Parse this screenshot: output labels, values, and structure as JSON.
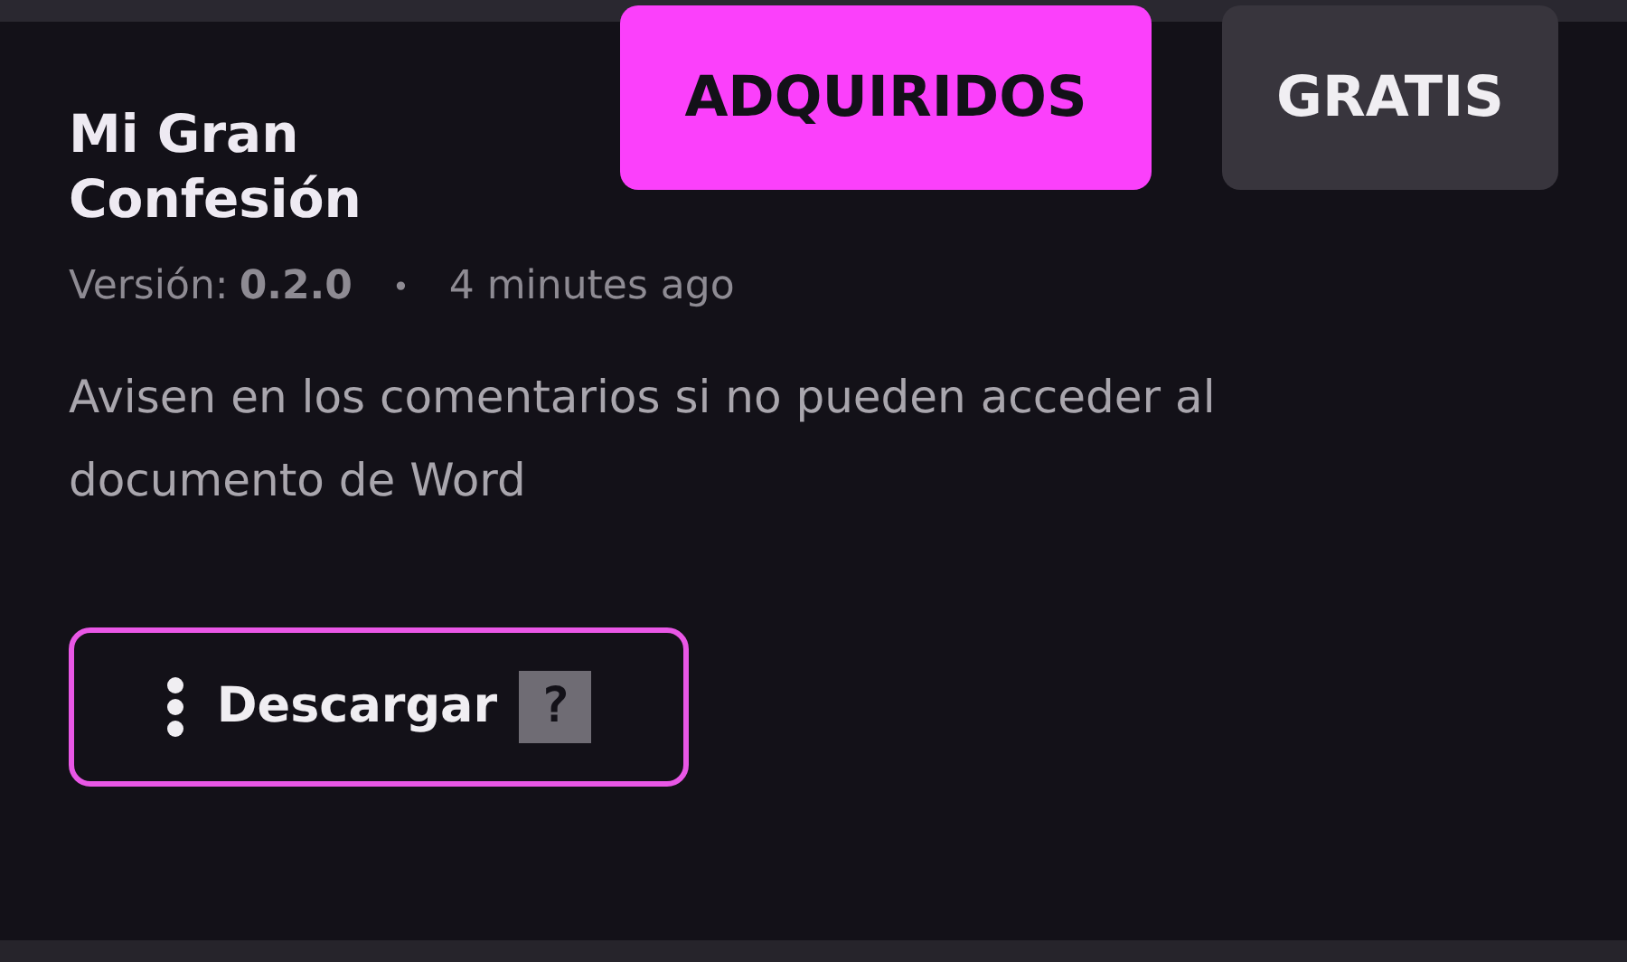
{
  "tabs": [
    {
      "label": "ADQUIRIDOS",
      "selected": true
    },
    {
      "label": "GRATIS",
      "selected": false
    }
  ],
  "item": {
    "title": "Mi Gran Confesión",
    "version_label": "Versión:",
    "version": "0.2.0",
    "separator": "•",
    "time": "4 minutes ago",
    "description": "Avisen en los comentarios si no pueden acceder al documento de Word"
  },
  "download_button": {
    "label": "Descargar",
    "glyph": "?"
  }
}
